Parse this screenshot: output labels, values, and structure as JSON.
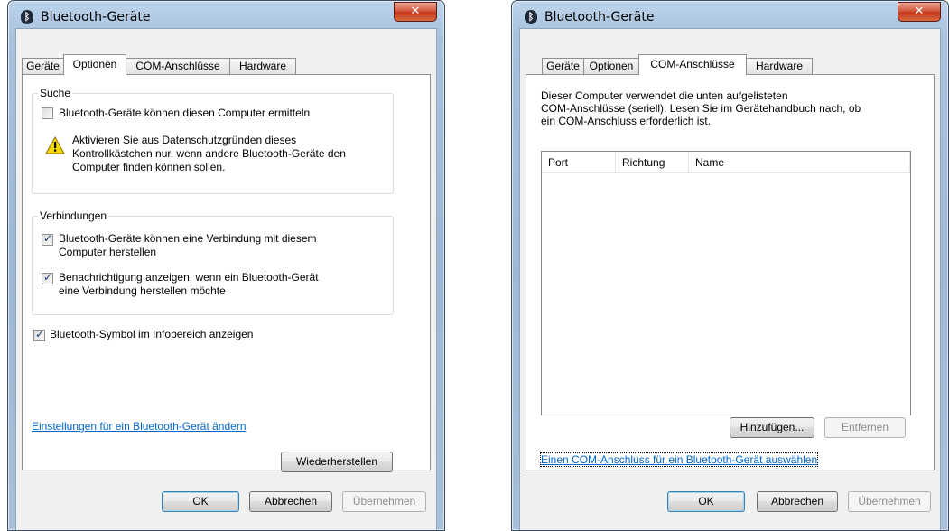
{
  "window_title": "Bluetooth-Geräte",
  "close_glyph": "✕",
  "bluetooth_glyph": "ᛒ",
  "tabs": [
    "Geräte",
    "Optionen",
    "COM-Anschlüsse",
    "Hardware"
  ],
  "options_tab": {
    "search_group": {
      "label": "Suche",
      "discover_checkbox": {
        "label": "Bluetooth-Geräte können diesen Computer ermitteln",
        "checked": false
      },
      "warning_line1": "Aktivieren Sie aus Datenschutzgründen dieses",
      "warning_line2": "Kontrollkästchen nur, wenn andere Bluetooth-Geräte den",
      "warning_line3": "Computer finden können sollen."
    },
    "connections_group": {
      "label": "Verbindungen",
      "allow_connect_line1": "Bluetooth-Geräte können eine Verbindung mit diesem",
      "allow_connect_line2": "Computer herstellen",
      "allow_connect_checked": true,
      "notify_line1": "Benachrichtigung anzeigen, wenn ein Bluetooth-Gerät",
      "notify_line2": "eine Verbindung herstellen möchte",
      "notify_checked": true
    },
    "show_icon": {
      "label": "Bluetooth-Symbol im Infobereich anzeigen",
      "checked": true
    },
    "settings_link": "Einstellungen für ein Bluetooth-Gerät ändern",
    "restore_button": "Wiederherstellen"
  },
  "com_tab": {
    "intro_line1": "Dieser Computer verwendet die unten aufgelisteten",
    "intro_line2": "COM-Anschlüsse (seriell). Lesen Sie im Gerätehandbuch nach, ob",
    "intro_line3": "ein COM-Anschluss erforderlich ist.",
    "columns": [
      "Port",
      "Richtung",
      "Name"
    ],
    "add_button": "Hinzufügen...",
    "remove_button": "Entfernen",
    "select_link": "Einen COM-Anschluss für ein Bluetooth-Gerät auswählen"
  },
  "footer": {
    "ok": "OK",
    "cancel": "Abbrechen",
    "apply": "Übernehmen"
  },
  "colors": {
    "link": "#0066cc",
    "title_gradient_top": "#bcd3ea",
    "close_red": "#c4381c",
    "panel_bg": "#f0f0f0"
  }
}
